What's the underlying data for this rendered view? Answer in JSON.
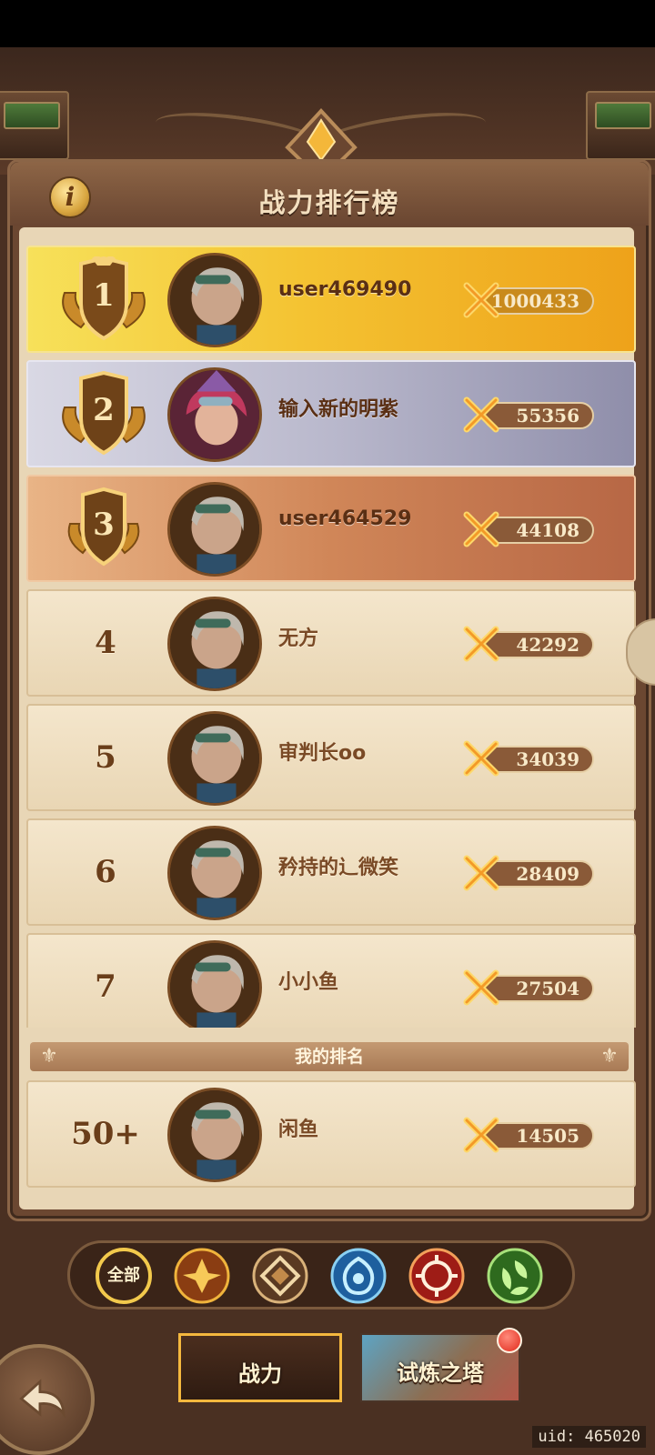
{
  "title": "战力排行榜",
  "info_icon": "i",
  "leaderboard": [
    {
      "rank": "1",
      "name": "user469490",
      "power": "1000433",
      "tier": "gold"
    },
    {
      "rank": "2",
      "name": "输入新的明紫",
      "power": "55356",
      "tier": "silver"
    },
    {
      "rank": "3",
      "name": "user464529",
      "power": "44108",
      "tier": "bronze"
    },
    {
      "rank": "4",
      "name": "无方",
      "power": "42292",
      "tier": "normal"
    },
    {
      "rank": "5",
      "name": "审判长oo",
      "power": "34039",
      "tier": "normal"
    },
    {
      "rank": "6",
      "name": "矜持的辶微笑",
      "power": "28409",
      "tier": "normal"
    },
    {
      "rank": "7",
      "name": "小小鱼",
      "power": "27504",
      "tier": "normal"
    }
  ],
  "my_rank": {
    "label": "我的排名",
    "rank": "50+",
    "name": "闲鱼",
    "power": "14505"
  },
  "filters": {
    "all_label": "全部",
    "items": [
      "全部",
      "faction-1",
      "faction-2",
      "faction-3",
      "faction-4",
      "faction-5"
    ],
    "selected": "全部"
  },
  "tabs": [
    {
      "label": "战力",
      "selected": true
    },
    {
      "label": "试炼之塔",
      "selected": false,
      "has_badge": true
    }
  ],
  "uid_text": "uid: 465020",
  "colors": {
    "gold": "#f4c332",
    "silver": "#b9b8cc",
    "bronze": "#d08658",
    "paper": "#e8d6b6",
    "frame": "#6b4731"
  }
}
